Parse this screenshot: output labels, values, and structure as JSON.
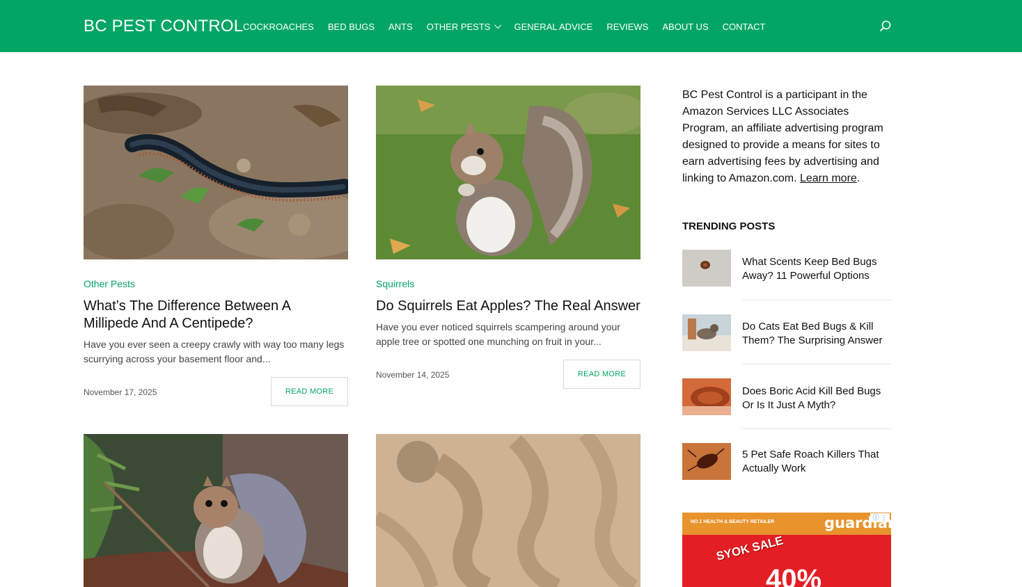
{
  "header": {
    "logo": "BC PEST CONTROL",
    "nav": [
      {
        "label": "COCKROACHES"
      },
      {
        "label": "BED BUGS"
      },
      {
        "label": "ANTS"
      },
      {
        "label": "OTHER PESTS"
      },
      {
        "label": "GENERAL ADVICE"
      },
      {
        "label": "REVIEWS"
      },
      {
        "label": "ABOUT US"
      },
      {
        "label": "CONTACT"
      }
    ],
    "search_icon": "search-icon",
    "bg_color": "#03a565"
  },
  "posts": [
    {
      "category": "Other Pests",
      "title": "What’s The Difference Between A Millipede And A Centipede?",
      "excerpt": "Have you ever seen a creepy crawly with way too many legs scurrying across your basement floor and...",
      "date": "November 17, 2025",
      "read_more": "READ MORE"
    },
    {
      "category": "Squirrels",
      "title": "Do Squirrels Eat Apples? The Real Answer",
      "excerpt": "Have you ever noticed squirrels scampering around your apple tree or spotted one munching on fruit in your...",
      "date": "November 14, 2025",
      "read_more": "READ MORE"
    }
  ],
  "sidebar": {
    "affiliate_text": "BC Pest Control is a participant in the Amazon Services LLC Associates Program, an affiliate advertising program designed to provide a means for sites to earn advertising fees by advertising and linking to Amazon.com.",
    "learn_more": "Learn more",
    "period": ".",
    "trending_title": "TRENDING POSTS",
    "trending": [
      {
        "title": "What Scents Keep Bed Bugs Away? 11 Powerful Options"
      },
      {
        "title": "Do Cats Eat Bed Bugs & Kill Them? The Surprising Answer"
      },
      {
        "title": "Does Boric Acid Kill Bed Bugs Or Is It Just A Myth?"
      },
      {
        "title": "5 Pet Safe Roach Killers That Actually Work"
      }
    ]
  },
  "ad": {
    "tagline": "NO.1 HEALTH & BEAUTY RETAILER",
    "brand": "guardian",
    "sale_text": "SYOK SALE",
    "percent_text": "40%"
  },
  "colors": {
    "accent": "#03a565",
    "text": "#111111",
    "muted": "#555555"
  }
}
